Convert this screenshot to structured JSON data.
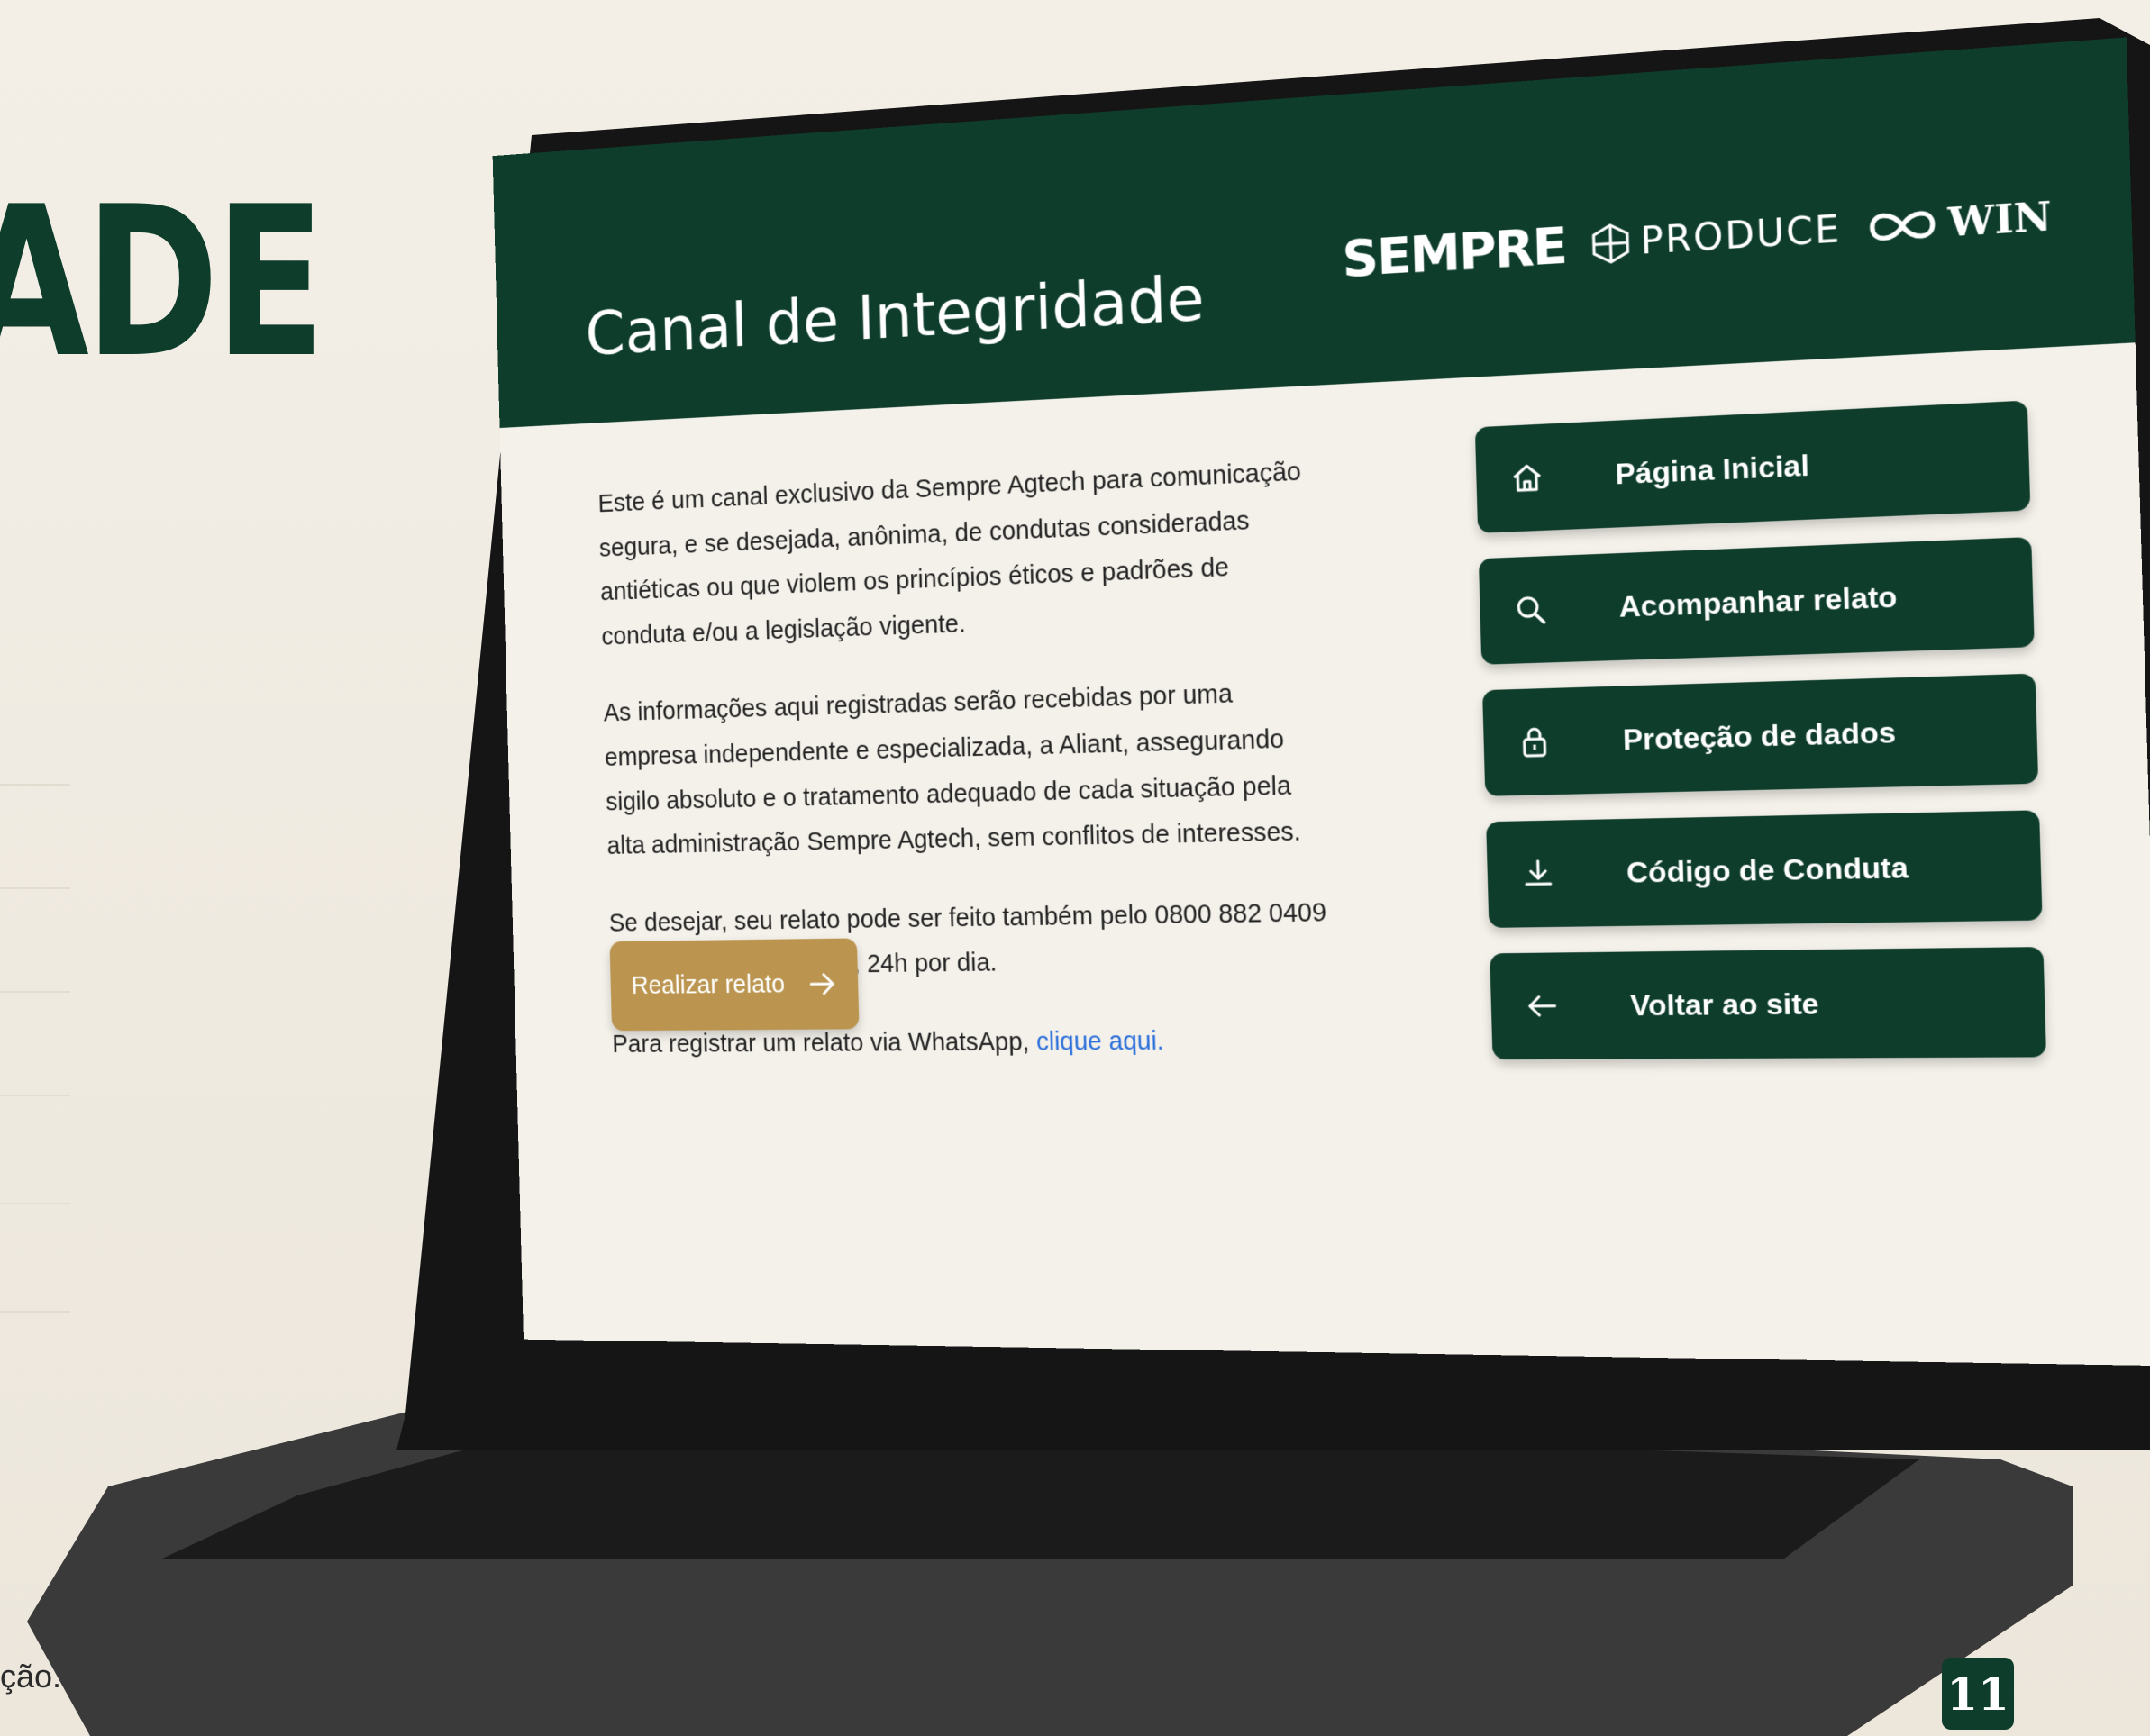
{
  "slide": {
    "title_fragment": "ADE",
    "bottom_text_fragment": "ção.",
    "page_number": "11"
  },
  "screen": {
    "title": "Canal de Integridade",
    "logos": {
      "sempre": "SEMPRE",
      "produce": "PRODUCE",
      "win": "WIN"
    },
    "intro": {
      "p1": "Este é um canal exclusivo da Sempre Agtech para comunicação segura, e se desejada, anônima, de condutas consideradas antiéticas ou que violem os princípios éticos e padrões de conduta e/ou a legislação vigente.",
      "p2": "As informações aqui registradas serão recebidas por uma empresa independente e especializada, a Aliant, assegurando sigilo absoluto e o tratamento adequado de cada situação pela alta administração Sempre Agtech, sem conflitos de interesses.",
      "p3": "Se desejar, seu relato pode ser feito também pelo 0800 882 0409 de segunda a domingo, 24h por dia.",
      "p4_prefix": "Para registrar um relato via WhatsApp, ",
      "p4_link": "clique aqui."
    },
    "report_button": {
      "label": "Realizar relato",
      "icon": "arrow-right-icon"
    },
    "nav": [
      {
        "label": "Página Inicial",
        "icon": "home-icon"
      },
      {
        "label": "Acompanhar relato",
        "icon": "search-icon"
      },
      {
        "label": "Proteção de dados",
        "icon": "lock-icon"
      },
      {
        "label": "Código de Conduta",
        "icon": "download-icon"
      },
      {
        "label": "Voltar ao site",
        "icon": "arrow-left-icon"
      }
    ]
  },
  "colors": {
    "brand_green": "#0e3d2c",
    "accent_gold": "#bb9550",
    "link_blue": "#2a6fdb",
    "page_background": "#f3efe7"
  }
}
